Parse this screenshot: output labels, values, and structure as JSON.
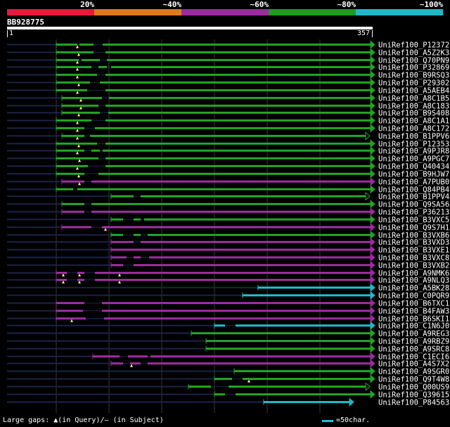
{
  "legend": {
    "labels": [
      "20%",
      "~40%",
      "~60%",
      "~80%",
      "~100%"
    ],
    "colors": [
      "#e8193a",
      "#e07a1e",
      "#9b2c9e",
      "#1e9c1e",
      "#20b8c8"
    ]
  },
  "query": {
    "id": "BB928775",
    "start": "1",
    "end": "357"
  },
  "colors": {
    "green": "#22a322",
    "purple": "#9b2c9e",
    "cyan": "#20b8c8",
    "dark": "#1c2448",
    "marker": "#ffff80",
    "grid": "#3a3a3a"
  },
  "hits": [
    {
      "label": "UniRef100_P12372",
      "color": "green",
      "start": 80,
      "end": 527,
      "arrow": "filled",
      "mk": [
        110
      ],
      "gaps": [
        [
          110,
          113
        ],
        [
          133,
          146
        ]
      ]
    },
    {
      "label": "UniRef100_A5Z2K3",
      "color": "green",
      "start": 80,
      "end": 527,
      "arrow": "filled",
      "mk": [
        112
      ],
      "gaps": [
        [
          133,
          150
        ]
      ]
    },
    {
      "label": "UniRef100_Q70PN9",
      "color": "green",
      "start": 80,
      "end": 527,
      "arrow": "filled",
      "mk": [
        110
      ],
      "gaps": [
        [
          112,
          116
        ],
        [
          142,
          152
        ]
      ]
    },
    {
      "label": "UniRef100_P32869",
      "color": "green",
      "start": 80,
      "end": 527,
      "arrow": "filled",
      "mk": [
        110
      ],
      "gaps": [
        [
          130,
          140
        ],
        [
          152,
          158
        ]
      ]
    },
    {
      "label": "UniRef100_B9RSQ3",
      "color": "green",
      "start": 80,
      "end": 527,
      "arrow": "filled",
      "mk": [
        110
      ],
      "gaps": [
        [
          138,
          150
        ]
      ]
    },
    {
      "label": "UniRef100_P29302",
      "color": "green",
      "start": 80,
      "end": 527,
      "arrow": "filled",
      "mk": [
        112
      ],
      "gaps": [
        [
          128,
          142
        ]
      ]
    },
    {
      "label": "UniRef100_A5AEB4",
      "color": "green",
      "start": 80,
      "end": 527,
      "arrow": "filled",
      "mk": [
        110
      ],
      "gaps": [
        [
          124,
          150
        ]
      ]
    },
    {
      "label": "UniRef100_A8C1B5",
      "color": "green",
      "start": 88,
      "end": 527,
      "arrow": "filled",
      "mk": [
        115
      ],
      "gaps": [
        [
          145,
          155
        ]
      ]
    },
    {
      "label": "UniRef100_A8C183",
      "color": "green",
      "start": 88,
      "end": 527,
      "arrow": "filled",
      "mk": [
        115
      ],
      "gaps": [
        [
          140,
          150
        ]
      ]
    },
    {
      "label": "UniRef100_B9S408",
      "color": "green",
      "start": 88,
      "end": 527,
      "arrow": "filled",
      "mk": [
        112
      ],
      "gaps": [
        [
          142,
          154
        ]
      ]
    },
    {
      "label": "UniRef100_A8C1A1",
      "color": "green",
      "start": 80,
      "end": 527,
      "arrow": "filled",
      "mk": [
        110
      ],
      "gaps": [
        [
          130,
          150
        ]
      ]
    },
    {
      "label": "UniRef100_A8C172",
      "color": "green",
      "start": 80,
      "end": 527,
      "arrow": "filled",
      "mk": [
        110
      ],
      "gaps": [
        [
          120,
          135
        ]
      ]
    },
    {
      "label": "UniRef100_B1PPV6",
      "color": "green",
      "start": 88,
      "end": 520,
      "arrow": "open",
      "mk": [
        110
      ],
      "gaps": [
        [
          120,
          128
        ]
      ]
    },
    {
      "label": "UniRef100_P12353",
      "color": "green",
      "start": 80,
      "end": 527,
      "arrow": "filled",
      "mk": [
        112
      ],
      "gaps": [
        [
          138,
          150
        ]
      ]
    },
    {
      "label": "UniRef100_A9PJR8",
      "color": "green",
      "start": 80,
      "end": 527,
      "arrow": "filled",
      "mk": [
        110
      ],
      "gaps": [
        [
          120,
          130
        ],
        [
          142,
          146
        ]
      ]
    },
    {
      "label": "UniRef100_A9PGC7",
      "color": "green",
      "start": 80,
      "end": 527,
      "arrow": "filled",
      "mk": [
        113
      ],
      "gaps": [
        [
          140,
          150
        ]
      ]
    },
    {
      "label": "UniRef100_Q40434",
      "color": "green",
      "start": 80,
      "end": 527,
      "arrow": "filled",
      "mk": [
        110
      ],
      "gaps": [
        [
          125,
          150
        ]
      ]
    },
    {
      "label": "UniRef100_B9HJW7",
      "color": "green",
      "start": 80,
      "end": 527,
      "arrow": "filled",
      "mk": [
        112
      ],
      "gaps": [
        [
          120,
          140
        ]
      ]
    },
    {
      "label": "UniRef100_A7PUB0",
      "color": "purple",
      "start": 88,
      "end": 527,
      "arrow": "filled",
      "mk": [
        113
      ],
      "gaps": [
        [
          120,
          130
        ]
      ]
    },
    {
      "label": "UniRef100_Q84PB4",
      "color": "green",
      "start": 80,
      "end": 527,
      "arrow": "filled",
      "mk": [],
      "gaps": [
        [
          104,
          110
        ]
      ]
    },
    {
      "label": "UniRef100_B1PPV4",
      "color": "green",
      "start": 158,
      "end": 520,
      "arrow": "open",
      "mk": [],
      "gaps": [
        [
          190,
          200
        ]
      ]
    },
    {
      "label": "UniRef100_Q9SA56",
      "color": "green",
      "start": 88,
      "end": 527,
      "arrow": "filled",
      "mk": [],
      "gaps": [
        [
          120,
          130
        ]
      ]
    },
    {
      "label": "UniRef100_P36213",
      "color": "purple",
      "start": 88,
      "end": 527,
      "arrow": "filled",
      "mk": [],
      "gaps": [
        [
          120,
          130
        ]
      ]
    },
    {
      "label": "UniRef100_B3VXC5",
      "color": "green",
      "start": 158,
      "end": 527,
      "arrow": "filled",
      "mk": [],
      "gaps": [
        [
          175,
          190
        ],
        [
          200,
          205
        ]
      ]
    },
    {
      "label": "UniRef100_Q9S7H1",
      "color": "purple",
      "start": 88,
      "end": 527,
      "arrow": "filled",
      "mk": [
        150
      ],
      "gaps": [
        [
          130,
          145
        ]
      ]
    },
    {
      "label": "UniRef100_B3VXB6",
      "color": "green",
      "start": 158,
      "end": 527,
      "arrow": "filled",
      "mk": [],
      "gaps": [
        [
          175,
          190
        ],
        [
          200,
          210
        ]
      ]
    },
    {
      "label": "UniRef100_B3VXD3",
      "color": "purple",
      "start": 158,
      "end": 527,
      "arrow": "filled",
      "mk": [],
      "gaps": [
        [
          190,
          200
        ]
      ]
    },
    {
      "label": "UniRef100_B3VXE1",
      "color": "purple",
      "start": 158,
      "end": 527,
      "arrow": "filled",
      "mk": [],
      "gaps": []
    },
    {
      "label": "UniRef100_B3VXC8",
      "color": "purple",
      "start": 158,
      "end": 527,
      "arrow": "filled",
      "mk": [],
      "gaps": [
        [
          180,
          190
        ],
        [
          200,
          212
        ]
      ]
    },
    {
      "label": "UniRef100_B3VXB2",
      "color": "purple",
      "start": 158,
      "end": 527,
      "arrow": "filled",
      "mk": [],
      "gaps": [
        [
          175,
          190
        ]
      ]
    },
    {
      "label": "UniRef100_A9NMK6",
      "color": "purple",
      "start": 80,
      "end": 527,
      "arrow": "filled",
      "mk": [
        90,
        113,
        170
      ],
      "gaps": [
        [
          95,
          110
        ],
        [
          120,
          135
        ]
      ]
    },
    {
      "label": "UniRef100_A9NLQ3",
      "color": "purple",
      "start": 80,
      "end": 527,
      "arrow": "filled",
      "mk": [
        90,
        113,
        170
      ],
      "gaps": [
        [
          95,
          110
        ],
        [
          120,
          135
        ]
      ]
    },
    {
      "label": "UniRef100_A5BK28",
      "color": "cyan",
      "start": 367,
      "end": 527,
      "arrow": "filled",
      "mk": [],
      "gaps": []
    },
    {
      "label": "UniRef100_C0PQR9",
      "color": "cyan",
      "start": 345,
      "end": 527,
      "arrow": "filled",
      "mk": [],
      "gaps": []
    },
    {
      "label": "UniRef100_B6TXC1",
      "color": "purple",
      "start": 80,
      "end": 527,
      "arrow": "filled",
      "mk": [],
      "gaps": [
        [
          120,
          145
        ]
      ]
    },
    {
      "label": "UniRef100_B4FAW3",
      "color": "purple",
      "start": 80,
      "end": 527,
      "arrow": "filled",
      "mk": [],
      "gaps": [
        [
          118,
          145
        ]
      ]
    },
    {
      "label": "UniRef100_B6SKI1",
      "color": "purple",
      "start": 80,
      "end": 527,
      "arrow": "filled",
      "mk": [
        102
      ],
      "gaps": [
        [
          122,
          148
        ]
      ]
    },
    {
      "label": "UniRef100_C1N6J0",
      "color": "cyan",
      "start": 305,
      "end": 527,
      "arrow": "filled",
      "mk": [],
      "gaps": [
        [
          320,
          335
        ]
      ]
    },
    {
      "label": "UniRef100_A9REG3",
      "color": "green",
      "start": 272,
      "end": 527,
      "arrow": "filled",
      "mk": [],
      "gaps": []
    },
    {
      "label": "UniRef100_A9RBZ9",
      "color": "green",
      "start": 293,
      "end": 527,
      "arrow": "filled",
      "mk": [],
      "gaps": []
    },
    {
      "label": "UniRef100_A9SRC8",
      "color": "green",
      "start": 293,
      "end": 527,
      "arrow": "filled",
      "mk": [],
      "gaps": []
    },
    {
      "label": "UniRef100_C1ECI6",
      "color": "purple",
      "start": 132,
      "end": 527,
      "arrow": "filled",
      "mk": [],
      "gaps": [
        [
          170,
          182
        ],
        [
          210,
          214
        ]
      ]
    },
    {
      "label": "UniRef100_A4S7X2",
      "color": "purple",
      "start": 158,
      "end": 527,
      "arrow": "filled",
      "mk": [
        187
      ],
      "gaps": [
        [
          175,
          185
        ],
        [
          200,
          210
        ]
      ]
    },
    {
      "label": "UniRef100_A9SGR0",
      "color": "green",
      "start": 333,
      "end": 527,
      "arrow": "filled",
      "mk": [],
      "gaps": []
    },
    {
      "label": "UniRef100_Q9T4W8",
      "color": "green",
      "start": 305,
      "end": 527,
      "arrow": "filled",
      "mk": [
        354
      ],
      "gaps": [
        [
          330,
          345
        ]
      ]
    },
    {
      "label": "UniRef100_Q00US9",
      "color": "green",
      "start": 268,
      "end": 520,
      "arrow": "open",
      "mk": [],
      "gaps": [
        [
          300,
          325
        ]
      ]
    },
    {
      "label": "UniRef100_Q39615",
      "color": "green",
      "start": 305,
      "end": 527,
      "arrow": "filled",
      "mk": [],
      "gaps": [
        [
          320,
          335
        ]
      ]
    },
    {
      "label": "UniRef100_P84563",
      "color": "cyan",
      "start": 375,
      "end": 497,
      "arrow": "filled",
      "mk": [],
      "gaps": []
    }
  ],
  "footer": {
    "text": "Large gaps: ▲(in Query)/– (in Subject)",
    "scale_text": "=50char."
  }
}
